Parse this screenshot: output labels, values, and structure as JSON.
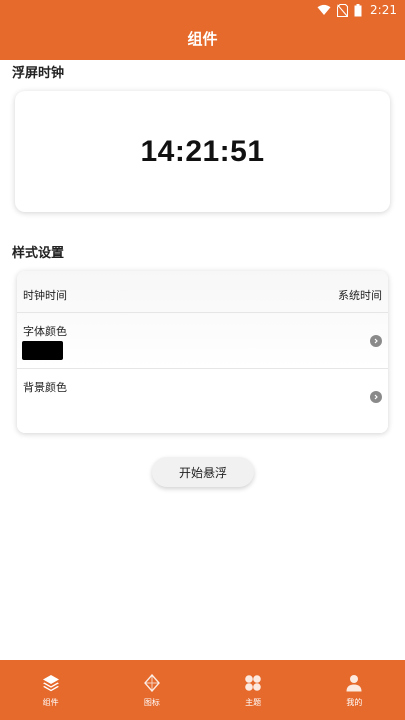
{
  "status_bar": {
    "time": "2:21"
  },
  "app_bar": {
    "title": "组件"
  },
  "floating_clock": {
    "section_title": "浮屏时钟",
    "time_display": "14:21:51"
  },
  "style_settings": {
    "section_title": "样式设置",
    "rows": [
      {
        "label": "时钟时间",
        "value": "系统时间"
      },
      {
        "label": "字体颜色",
        "swatch_color": "#000000"
      },
      {
        "label": "背景颜色",
        "swatch_color": "#ffffff"
      }
    ]
  },
  "start_button": {
    "label": "开始悬浮"
  },
  "bottom_nav": {
    "items": [
      {
        "label": "组件",
        "icon": "layers-icon"
      },
      {
        "label": "图标",
        "icon": "shape-icon"
      },
      {
        "label": "主题",
        "icon": "theme-icon"
      },
      {
        "label": "我的",
        "icon": "person-icon"
      }
    ]
  },
  "colors": {
    "accent": "#E66A2C"
  }
}
